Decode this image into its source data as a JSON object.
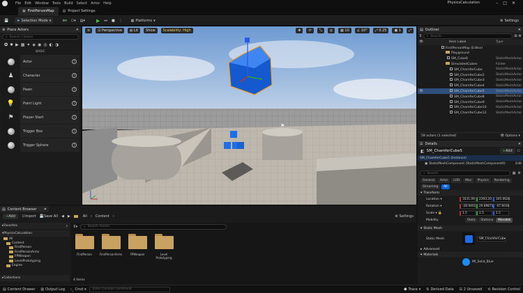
{
  "menu": {
    "items": [
      "File",
      "Edit",
      "Window",
      "Tools",
      "Build",
      "Select",
      "Actor",
      "Help"
    ],
    "project": "PhysicsCalculation"
  },
  "tabs": [
    {
      "label": "FirstPersonMap"
    },
    {
      "label": "Project Settings"
    }
  ],
  "toolbar": {
    "selection_mode": "Selection Mode",
    "platforms": "Platforms",
    "settings": "Settings"
  },
  "place_actors": {
    "title": "Place Actors",
    "search_placeholder": "Search Classes",
    "category": "BASIC",
    "items": [
      {
        "label": "Actor"
      },
      {
        "label": "Character"
      },
      {
        "label": "Pawn"
      },
      {
        "label": "Point Light"
      },
      {
        "label": "Player Start"
      },
      {
        "label": "Trigger Box"
      },
      {
        "label": "Trigger Sphere"
      }
    ]
  },
  "viewport": {
    "perspective": "Perspective",
    "lit": "Lit",
    "show": "Show",
    "scalability": "Scalability: High",
    "grid": "10",
    "angle": "10°",
    "scale": "0.25",
    "cam": "1"
  },
  "outliner": {
    "title": "Outliner",
    "search_placeholder": "Search...",
    "col_label": "Item Label",
    "col_type": "Type",
    "rows": [
      {
        "name": "FirstPersonMap (Editor)",
        "type": ""
      },
      {
        "name": "Playground",
        "type": ""
      },
      {
        "name": "SM_Cube6",
        "type": "StaticMeshActor"
      },
      {
        "name": "SimulatedCubes",
        "type": "Folder"
      },
      {
        "name": "SM_ChamferCube",
        "type": "StaticMeshActor"
      },
      {
        "name": "SM_ChamferCube2",
        "type": "StaticMeshActor"
      },
      {
        "name": "SM_ChamferCube3",
        "type": "StaticMeshActor"
      },
      {
        "name": "SM_ChamferCube4",
        "type": "StaticMeshActor"
      },
      {
        "name": "SM_ChamferCube5",
        "type": "StaticMeshActor"
      },
      {
        "name": "SM_ChamferCube8",
        "type": "StaticMeshActor"
      },
      {
        "name": "SM_ChamferCube9",
        "type": "StaticMeshActor"
      },
      {
        "name": "SM_ChamferCube10",
        "type": "StaticMeshActor"
      },
      {
        "name": "SM_ChamferCube12",
        "type": "StaticMeshActor"
      }
    ],
    "status": "59 actors (1 selected)"
  },
  "details": {
    "title": "Details",
    "object_name": "SM_ChamferCube5",
    "add": "Add",
    "instance": "SM_ChamferCube5 (Instance)",
    "component": "StaticMeshComponent (StaticMeshComponent0)",
    "edit": "Edit",
    "search_placeholder": "Search",
    "filter_tabs": [
      "General",
      "Actor",
      "LOD",
      "Misc",
      "Physics",
      "Rendering",
      "Streaming",
      "All"
    ],
    "transform": "Transform",
    "location": {
      "label": "Location",
      "x": "1631.09",
      "y": "2393.20",
      "z": "345.0626"
    },
    "rotation": {
      "label": "Rotation",
      "x": "-28.9401",
      "y": "29.89871",
      "z": "-47.6036"
    },
    "scale": {
      "label": "Scale",
      "x": "1.5",
      "y": "1.5",
      "z": "1.5"
    },
    "mobility": {
      "label": "Mobility",
      "options": [
        "Static",
        "Stationa",
        "Movable"
      ]
    },
    "static_mesh_section": "Static Mesh",
    "static_mesh_label": "Static Mesh",
    "static_mesh_value": "SM_ChamferCub",
    "advanced": "Advanced",
    "materials": "Materials",
    "material_value": "MI_Solid_Blue"
  },
  "content_browser": {
    "title": "Content Browser",
    "add": "Add",
    "import": "Import",
    "save_all": "Save All",
    "path_all": "All",
    "path_content": "Content",
    "settings": "Settings",
    "search_placeholder": "Search Assets",
    "favorites": "Favorites",
    "project": "PhysicsCalculation",
    "tree": [
      "All",
      "Content",
      "FirstPerson",
      "FirstPersonArms",
      "FPWeapon",
      "LevelPrototyping",
      "Engine"
    ],
    "folders": [
      {
        "label": "FirstPerson"
      },
      {
        "label": "FirstPersonArms"
      },
      {
        "label": "FPWeapon"
      },
      {
        "label": "Level Prototyping"
      }
    ],
    "item_count": "4 items",
    "collections": "Collections"
  },
  "statusbar": {
    "content_drawer": "Content Drawer",
    "output_log": "Output Log",
    "cmd": "Cmd",
    "console_placeholder": "Enter Console Command",
    "trace": "Trace",
    "derived_data": "Derived Data",
    "unsaved": "2 Unsaved",
    "revision": "Revision Control"
  }
}
